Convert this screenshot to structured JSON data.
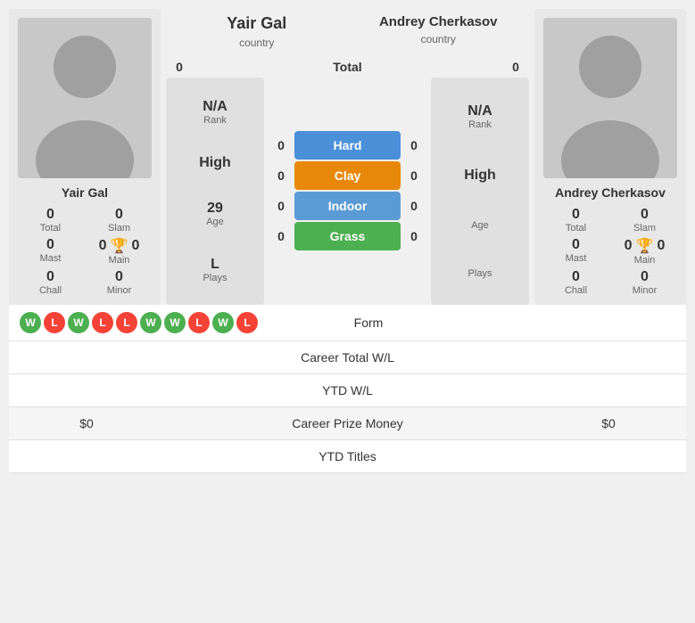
{
  "player_left": {
    "name": "Yair Gal",
    "country": "country",
    "avatar_bg": "#c0c0c0",
    "rank_label": "Rank",
    "rank_value": "N/A",
    "high_label": "High",
    "high_value": "High",
    "age_label": "Age",
    "age_value": "29",
    "plays_label": "Plays",
    "plays_value": "L",
    "total": "0",
    "slam": "0",
    "mast": "0",
    "main": "0",
    "chall": "0",
    "minor": "0"
  },
  "player_right": {
    "name": "Andrey Cherkasov",
    "country": "country",
    "avatar_bg": "#c0c0c0",
    "rank_label": "Rank",
    "rank_value": "N/A",
    "high_label": "High",
    "high_value": "High",
    "age_label": "Age",
    "age_value": "",
    "plays_label": "Plays",
    "plays_value": "",
    "total": "0",
    "slam": "0",
    "mast": "0",
    "main": "0",
    "chall": "0",
    "minor": "0"
  },
  "surfaces": {
    "total_label": "Total",
    "total_left": "0",
    "total_right": "0",
    "hard_label": "Hard",
    "hard_left": "0",
    "hard_right": "0",
    "clay_label": "Clay",
    "clay_left": "0",
    "clay_right": "0",
    "indoor_label": "Indoor",
    "indoor_left": "0",
    "indoor_right": "0",
    "grass_label": "Grass",
    "grass_left": "0",
    "grass_right": "0"
  },
  "form": {
    "label": "Form",
    "badges": [
      "W",
      "L",
      "W",
      "L",
      "L",
      "W",
      "W",
      "L",
      "W",
      "L"
    ]
  },
  "stats": [
    {
      "label": "Career Total W/L",
      "left": "",
      "right": ""
    },
    {
      "label": "YTD W/L",
      "left": "",
      "right": ""
    },
    {
      "label": "Career Prize Money",
      "left": "$0",
      "right": "$0"
    },
    {
      "label": "YTD Titles",
      "left": "",
      "right": ""
    }
  ]
}
